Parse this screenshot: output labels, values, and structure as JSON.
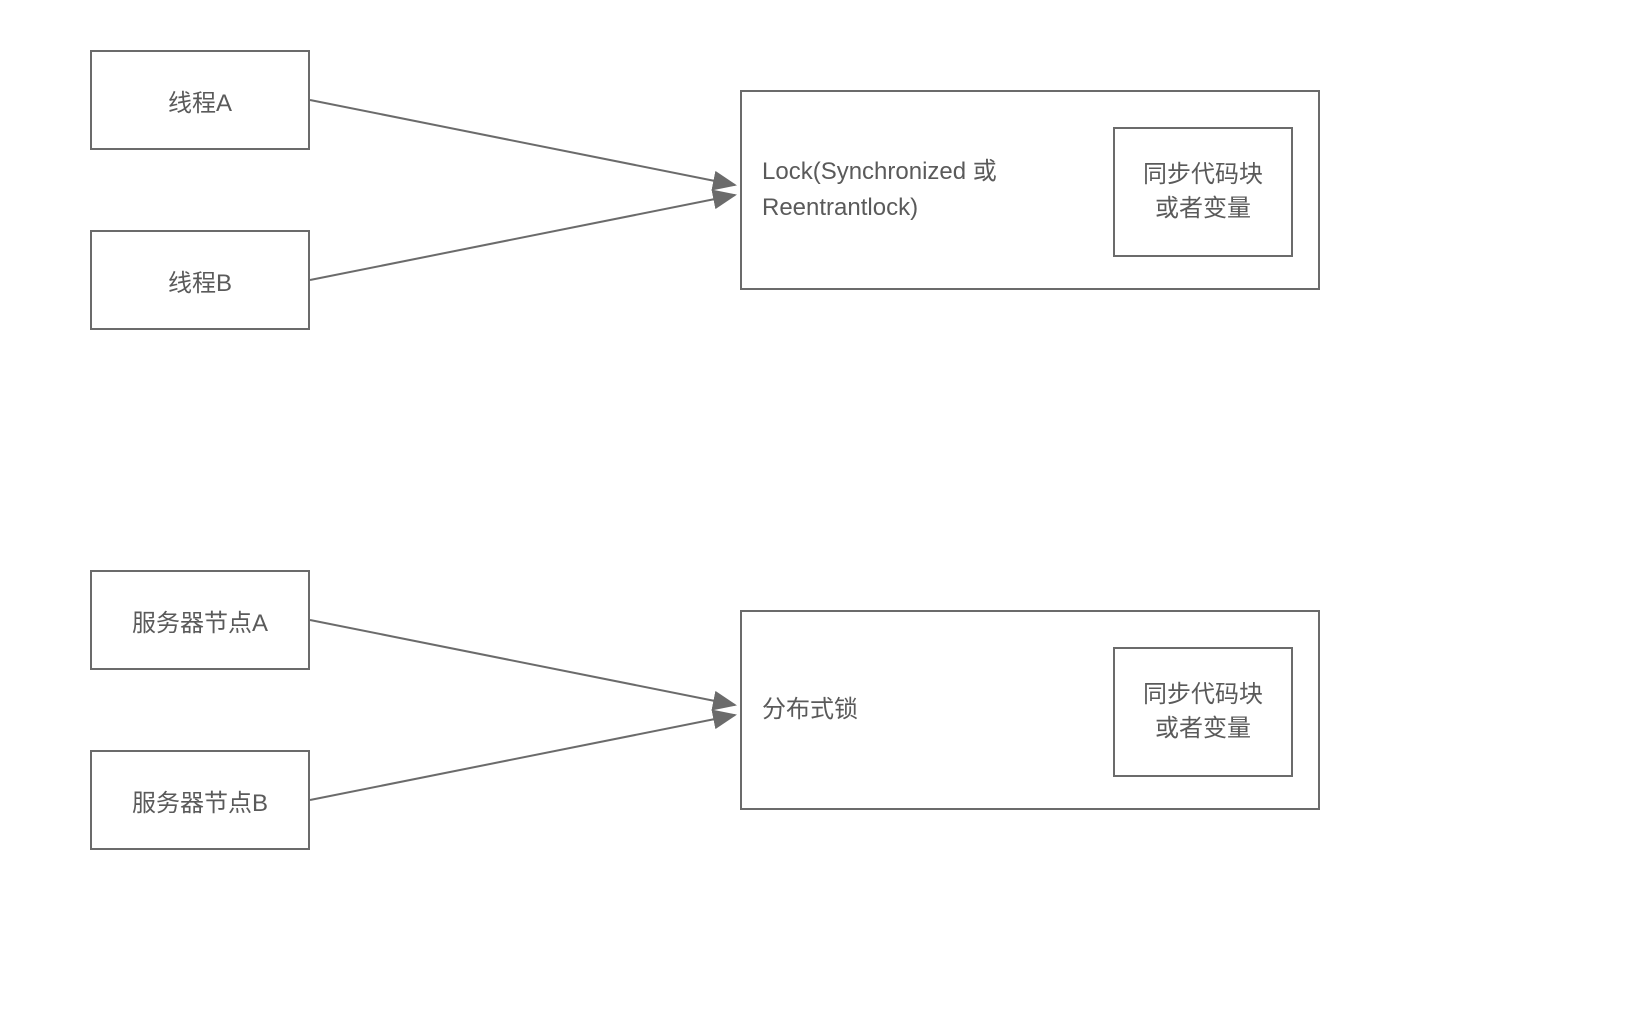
{
  "diagram1": {
    "threadA": "线程A",
    "threadB": "线程B",
    "lockLabel": "Lock(Synchronized 或Reentrantlock)",
    "syncBlockLine1": "同步代码块",
    "syncBlockLine2": "或者变量"
  },
  "diagram2": {
    "nodeA": "服务器节点A",
    "nodeB": "服务器节点B",
    "distLockLabel": "分布式锁",
    "syncBlockLine1": "同步代码块",
    "syncBlockLine2": "或者变量"
  }
}
